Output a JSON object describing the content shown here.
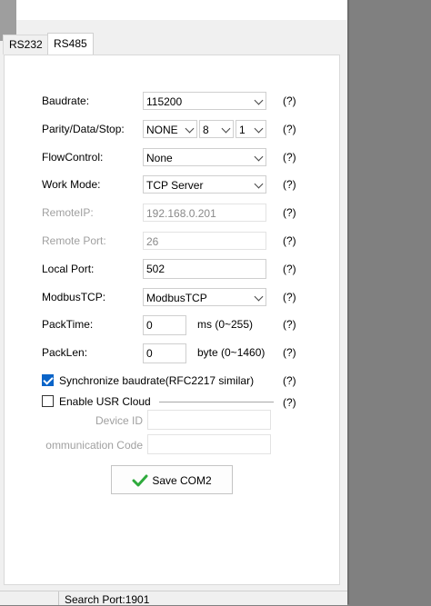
{
  "tabs": [
    {
      "label": "RS232"
    },
    {
      "label": "RS485"
    }
  ],
  "form": {
    "baudrate": {
      "label": "Baudrate:",
      "value": "115200",
      "help": "(?)"
    },
    "parity": {
      "label": "Parity/Data/Stop:",
      "parity": "NONE",
      "data": "8",
      "stop": "1",
      "help": "(?)"
    },
    "flow": {
      "label": "FlowControl:",
      "value": "None",
      "help": "(?)"
    },
    "work_mode": {
      "label": "Work Mode:",
      "value": "TCP Server",
      "help": "(?)"
    },
    "remote_ip": {
      "label": "RemoteIP:",
      "value": "192.168.0.201",
      "help": "(?)"
    },
    "remote_port": {
      "label": "Remote Port:",
      "value": "26",
      "help": "(?)"
    },
    "local_port": {
      "label": "Local Port:",
      "value": "502",
      "help": "(?)"
    },
    "modbus": {
      "label": "ModbusTCP:",
      "value": "ModbusTCP",
      "help": "(?)"
    },
    "pack_time": {
      "label": "PackTime:",
      "value": "0",
      "unit": "ms (0~255)",
      "help": "(?)"
    },
    "pack_len": {
      "label": "PackLen:",
      "value": "0",
      "unit": "byte (0~1460)",
      "help": "(?)"
    },
    "sync": {
      "label": "Synchronize baudrate(RFC2217 similar)",
      "checked": true,
      "help": "(?)"
    },
    "cloud": {
      "label": "Enable USR Cloud",
      "checked": false,
      "help": "(?)"
    },
    "device_id": {
      "label": "Device ID",
      "value": ""
    },
    "comm_code": {
      "label": "ommunication Code",
      "value": ""
    }
  },
  "save_button": {
    "label": "Save COM2",
    "icon": "check-icon",
    "icon_color": "#2eaa3c"
  },
  "status": {
    "text": "Search Port:1901"
  }
}
